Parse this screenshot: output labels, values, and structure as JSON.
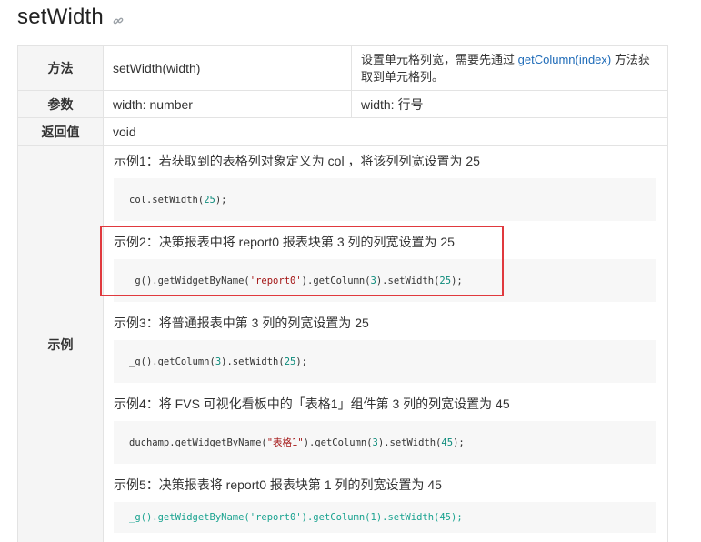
{
  "title": "setWidth",
  "rows": {
    "method": {
      "label": "方法",
      "value": "setWidth(width)",
      "desc_prefix": "设置单元格列宽，需要先通过",
      "desc_link": "getColumn(index)",
      "desc_suffix": "方法获取到单元格列。"
    },
    "param": {
      "label": "参数",
      "value": "width: number",
      "desc": "width:  行号"
    },
    "return": {
      "label": "返回值",
      "value": "void"
    },
    "examples": {
      "label": "示例",
      "items": [
        {
          "title": "示例1：若获取到的表格列对象定义为 col ，将该列列宽设置为 25",
          "code_pre": "col.setWidth(",
          "code_num1": "25",
          "code_post": ");"
        },
        {
          "title": "示例2：决策报表中将 report0 报表块第 3 列的列宽设置为 25",
          "code_a": "_g().getWidgetByName(",
          "code_str": "'report0'",
          "code_b": ").getColumn(",
          "code_num1": "3",
          "code_c": ").setWidth(",
          "code_num2": "25",
          "code_d": ");"
        },
        {
          "title": "示例3：将普通报表中第 3 列的列宽设置为 25",
          "code_a": "_g().getColumn(",
          "code_num1": "3",
          "code_b": ").setWidth(",
          "code_num2": "25",
          "code_c": ");"
        },
        {
          "title": "示例4：将 FVS 可视化看板中的「表格1」组件第 3 列的列宽设置为 45",
          "code_a": "duchamp.getWidgetByName(",
          "code_str": "\"表格1\"",
          "code_b": ").getColumn(",
          "code_num1": "3",
          "code_c": ").setWidth(",
          "code_num2": "45",
          "code_d": ");"
        },
        {
          "title": "示例5：决策报表将 report0 报表块第 1 列的列宽设置为 45",
          "code": "_g().getWidgetByName('report0').getColumn(1).setWidth(45);"
        }
      ]
    }
  },
  "colors": {
    "link": "#1e6bb8",
    "highlight": "#e0393e",
    "number": "#0b8a7a",
    "string": "#a31515",
    "code_teal": "#1aa390"
  }
}
